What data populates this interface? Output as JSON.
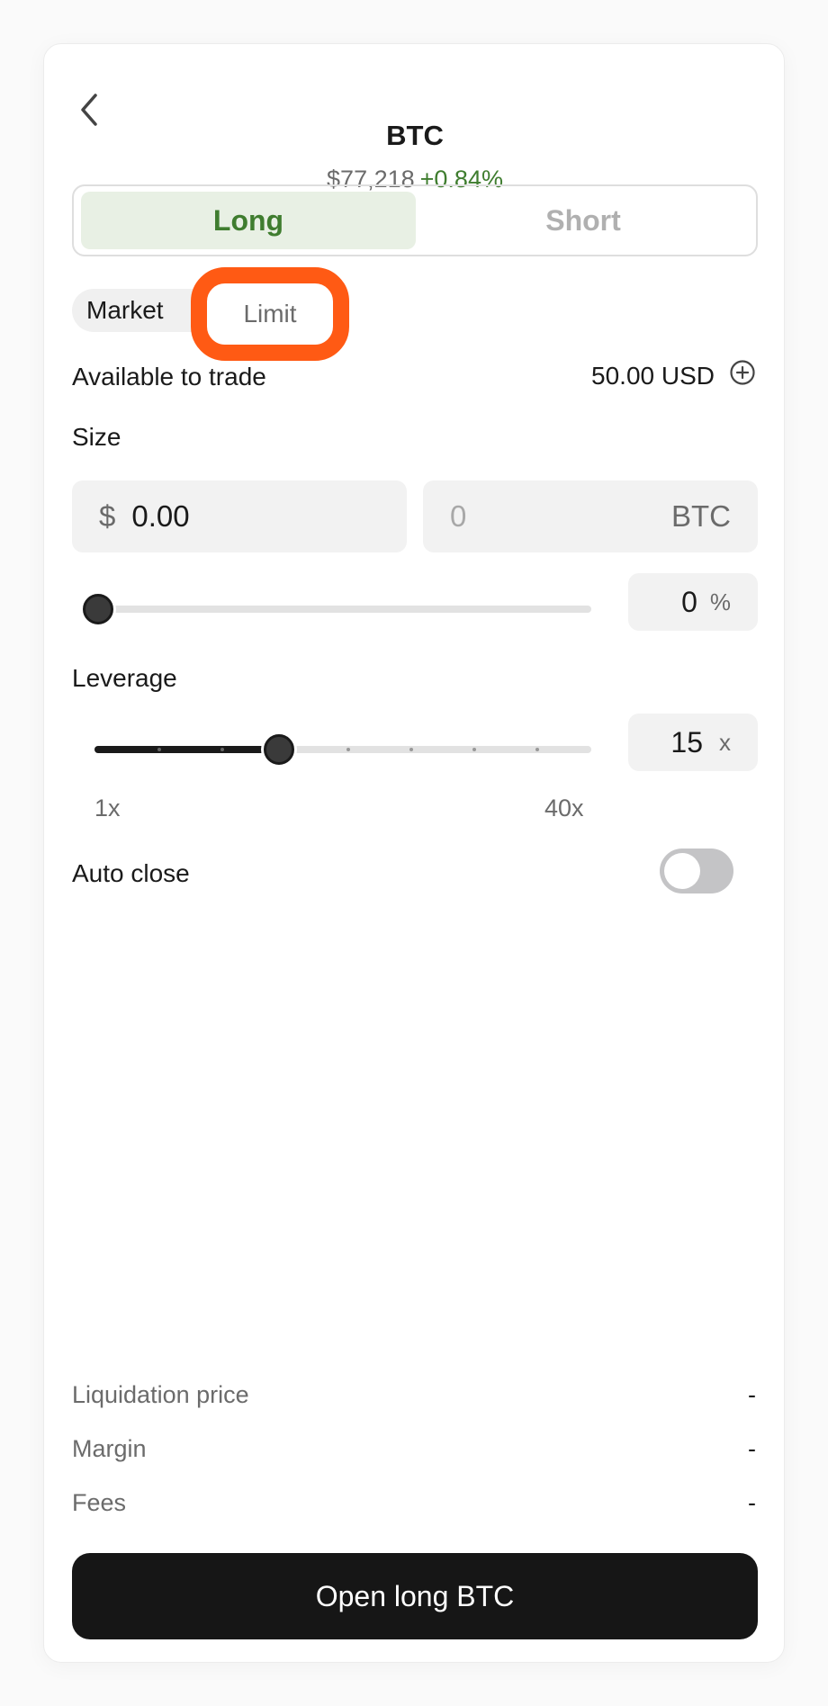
{
  "header": {
    "title": "BTC",
    "price": "$77,218",
    "change": "+0.84%"
  },
  "side": {
    "long_label": "Long",
    "short_label": "Short",
    "selected": "Long"
  },
  "order_type": {
    "market_label": "Market",
    "limit_label": "Limit",
    "highlighted": "Limit"
  },
  "available": {
    "label": "Available to trade",
    "value": "50.00 USD"
  },
  "size": {
    "label": "Size",
    "usd_prefix": "$",
    "usd_value": "0.00",
    "btc_placeholder": "0",
    "btc_unit": "BTC",
    "percent_value": "0",
    "percent_unit": "%",
    "slider_fraction": 0
  },
  "leverage": {
    "label": "Leverage",
    "value": "15",
    "unit": "x",
    "min_label": "1x",
    "max_label": "40x",
    "min": 1,
    "max": 40,
    "current": 15
  },
  "auto_close": {
    "label": "Auto close",
    "enabled": false
  },
  "summary": [
    {
      "label": "Liquidation price",
      "value": "-"
    },
    {
      "label": "Margin",
      "value": "-"
    },
    {
      "label": "Fees",
      "value": "-"
    }
  ],
  "cta": {
    "label": "Open long BTC"
  },
  "colors": {
    "positive": "#3f7d2f",
    "long_bg": "#e8f0e4",
    "highlight_ring": "#ff5a14",
    "cta_bg": "#161616"
  },
  "icons": {
    "back": "chevron-left-icon",
    "add_funds": "plus-circle-icon"
  }
}
